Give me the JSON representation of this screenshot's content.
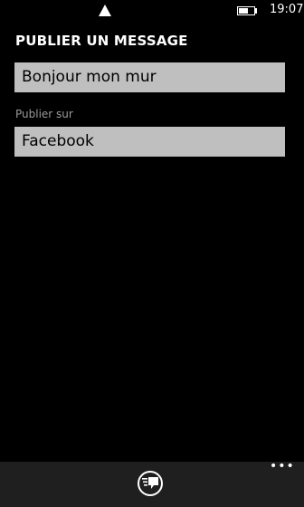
{
  "status_bar": {
    "signal_icon": "signal-triangle-icon",
    "battery_icon": "battery-icon",
    "battery_level": 0.6,
    "time": "19:07"
  },
  "page": {
    "title": "PUBLIER UN MESSAGE"
  },
  "message": {
    "value": "Bonjour mon mur"
  },
  "publish_on": {
    "label": "Publier sur",
    "selected": "Facebook"
  },
  "app_bar": {
    "send_icon": "send-message-icon",
    "more_label": "•••"
  },
  "colors": {
    "background": "#000000",
    "field_background": "#bfbfbf",
    "app_bar_background": "#1f1f1f",
    "label_gray": "#9a9a9a"
  }
}
